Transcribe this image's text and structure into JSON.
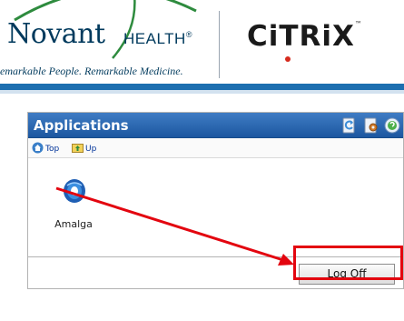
{
  "header": {
    "novant_word": "Novant",
    "health_word": "HEALTH",
    "registered_mark": "®",
    "tagline": "emarkable People. Remarkable Medicine.",
    "citrix_word": "CiTRiX",
    "citrix_tm": "™"
  },
  "panel": {
    "title": "Applications",
    "header_icons": [
      "refresh-icon",
      "settings-icon",
      "help-icon"
    ],
    "toolbar": [
      {
        "label": "Top",
        "icon": "home-icon"
      },
      {
        "label": "Up",
        "icon": "folder-up-icon"
      }
    ],
    "apps": [
      {
        "label": "Amalga",
        "icon": "amalga-app-icon"
      }
    ],
    "logoff_label": "Log Off"
  },
  "colors": {
    "brand_navy": "#003a5d",
    "brand_green": "#2e8b3e",
    "citrix_red": "#d62b1e",
    "header_blue": "#1c57a0",
    "annotation_red": "#e3050f"
  }
}
